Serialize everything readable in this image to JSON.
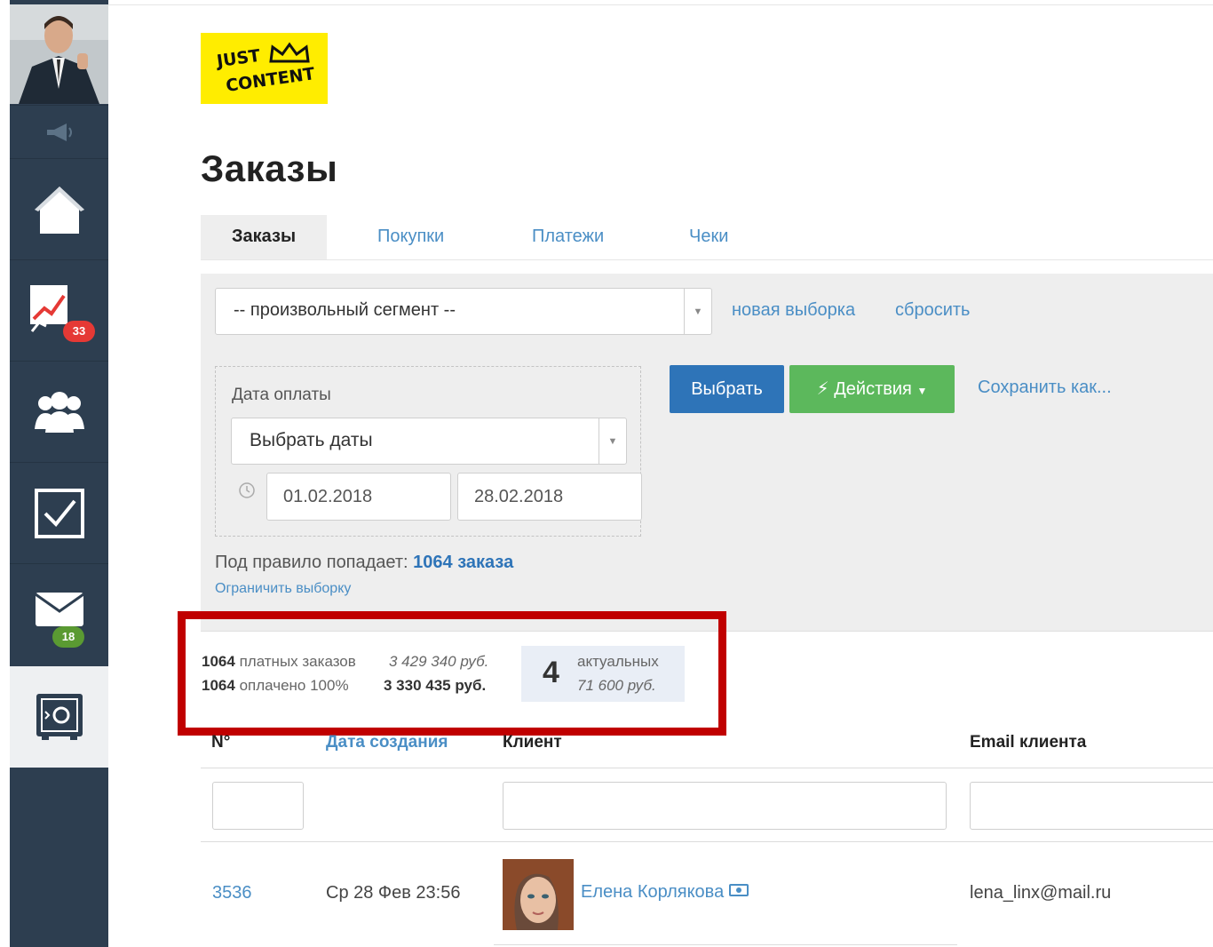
{
  "sidebar": {
    "badges": {
      "analytics": "33",
      "mail": "18"
    },
    "colors": {
      "background": "#2d3e50",
      "badge_red": "#e53935",
      "badge_green": "#5a9a32"
    }
  },
  "logo": {
    "line1": "JUST",
    "line2": "CONTENT"
  },
  "page": {
    "title": "Заказы"
  },
  "tabs": [
    {
      "label": "Заказы",
      "active": true
    },
    {
      "label": "Покупки",
      "active": false
    },
    {
      "label": "Платежи",
      "active": false
    },
    {
      "label": "Чеки",
      "active": false
    }
  ],
  "filter": {
    "segment_value": "-- произвольный сегмент --",
    "new_selection": "новая выборка",
    "reset": "сбросить",
    "payment_date_label": "Дата оплаты",
    "date_select_value": "Выбрать даты",
    "date_from": "01.02.2018",
    "date_to": "28.02.2018",
    "select_button": "Выбрать",
    "actions_button": "Действия",
    "save_as": "Сохранить как...",
    "rule_prefix": "Под правило попадает:",
    "rule_count": "1064 заказа",
    "limit_link": "Ограничить выборку"
  },
  "stats": {
    "paid_count": "1064",
    "paid_label": "платных заказов",
    "paid_sum": "3 429 340 руб.",
    "settled_count": "1064",
    "settled_label": "оплачено 100%",
    "settled_sum": "3 330 435 руб.",
    "actual_count": "4",
    "actual_label": "актуальных",
    "actual_sum": "71 600 руб."
  },
  "table": {
    "columns": [
      "N°",
      "Дата создания",
      "Клиент",
      "Email клиента"
    ],
    "rows": [
      {
        "id": "3536",
        "created": "Ср 28 Фев 23:56",
        "client": "Елена Корлякова",
        "email": "lena_linx@mail.ru"
      }
    ]
  }
}
